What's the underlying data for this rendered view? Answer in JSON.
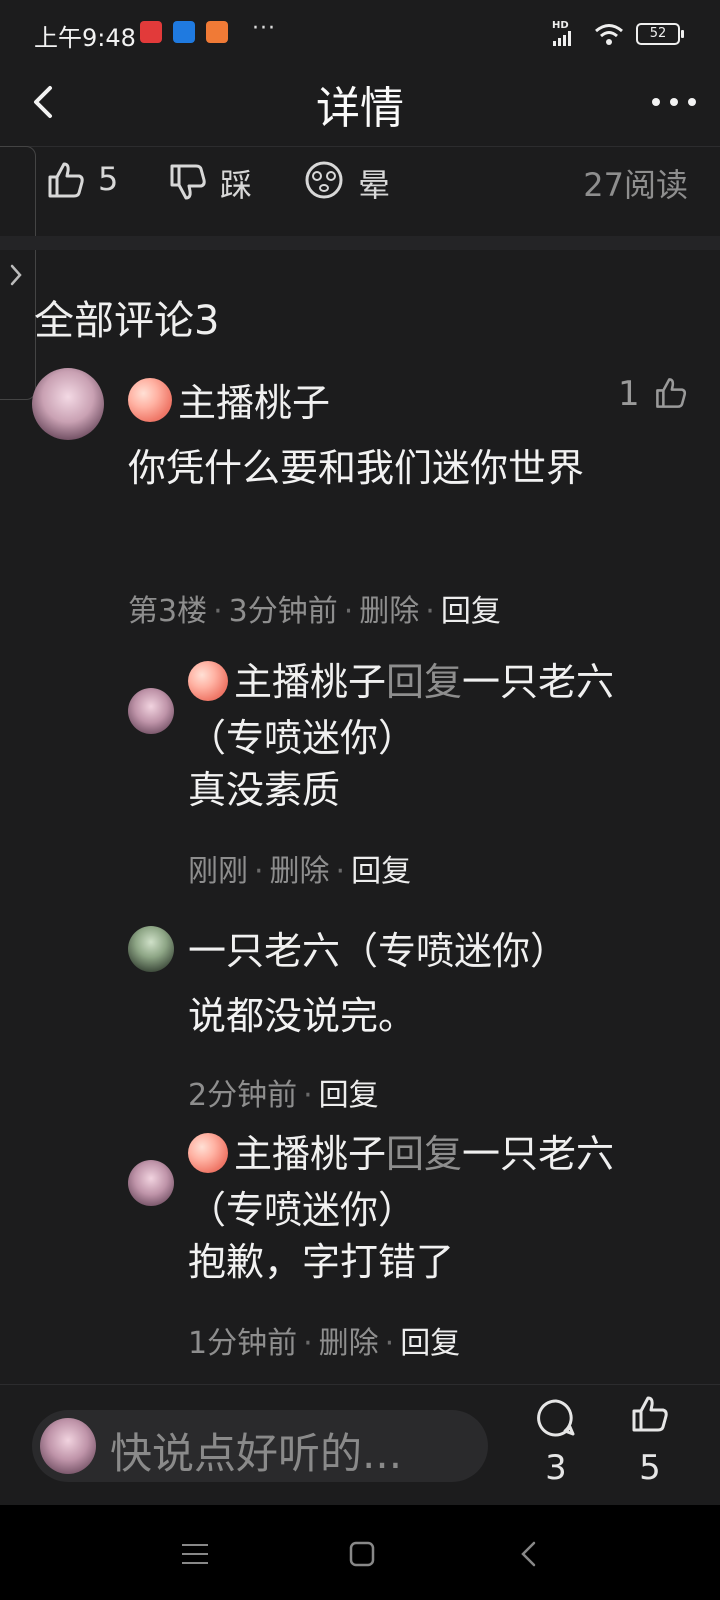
{
  "status_bar": {
    "time": "上午9:48",
    "more": "···",
    "network": "HD",
    "battery": "52",
    "app_icons": [
      "toutiao-icon",
      "app-blue-icon",
      "mi-store-icon"
    ]
  },
  "header": {
    "title": "详情"
  },
  "reactions": {
    "like_count": "5",
    "dislike_label": "踩",
    "dizzy_label": "晕",
    "read_count": "27阅读"
  },
  "comments_section": {
    "title": "全部评论3"
  },
  "main_comment": {
    "author": "主播桃子",
    "like_count": "1",
    "text": "你凭什么要和我们迷你世界",
    "meta": {
      "floor": "第3楼",
      "time": "3分钟前",
      "delete": "删除",
      "reply": "回复"
    }
  },
  "replies": [
    {
      "author": "主播桃子",
      "reply_word": "回复",
      "target": "一只老六（专喷迷你）",
      "text": "真没素质",
      "time": "刚刚",
      "delete": "删除",
      "reply": "回复"
    },
    {
      "author": "一只老六（专喷迷你）",
      "text": "说都没说完。",
      "time": "2分钟前",
      "reply": "回复"
    },
    {
      "author": "主播桃子",
      "reply_word": "回复",
      "target": "一只老六（专喷迷你）",
      "text": "抱歉，字打错了",
      "time": "1分钟前",
      "delete": "删除",
      "reply": "回复"
    }
  ],
  "bottom_bar": {
    "placeholder": "快说点好听的...",
    "comment_count": "3",
    "like_count": "5"
  },
  "colors": {
    "background": "#1c1c1d",
    "muted_text": "#8e8e8e",
    "primary_text": "#f0f0f0"
  }
}
